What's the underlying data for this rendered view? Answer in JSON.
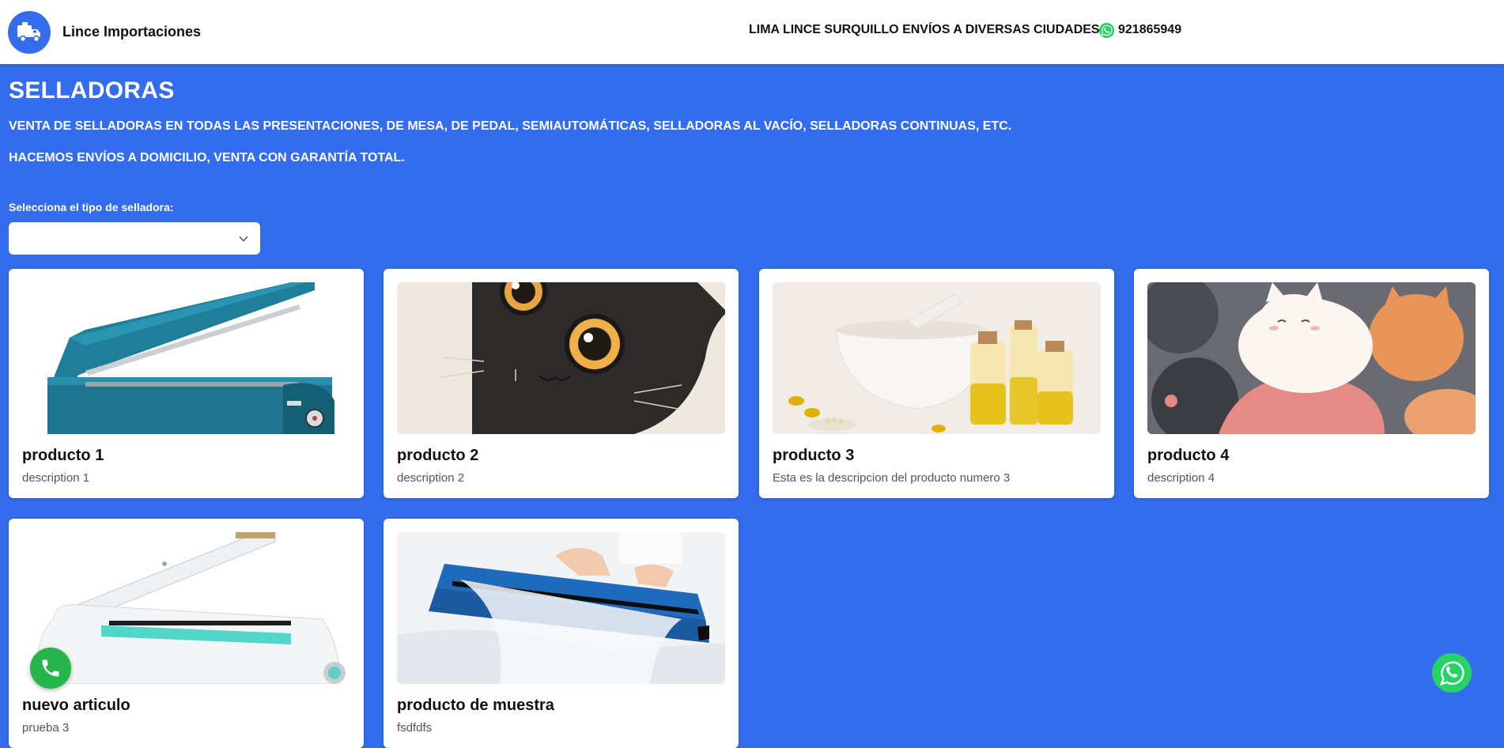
{
  "header": {
    "brand": "Lince Importaciones",
    "info": "LIMA LINCE SURQUILLO ENVÍOS A DIVERSAS CIUDADES",
    "phone": "921865949",
    "logo_icon": "delivery-truck-icon"
  },
  "hero": {
    "title": "SELLADORAS",
    "subtitle_1": "VENTA DE SELLADORAS EN TODAS LAS PRESENTACIONES, DE MESA, DE PEDAL, SEMIAUTOMÁTICAS, SELLADORAS AL VACÍO, SELLADORAS CONTINUAS, ETC.",
    "subtitle_2": "HACEMOS ENVÍOS A DOMICILIO, VENTA CON GARANTÍA TOTAL."
  },
  "filter": {
    "label": "Selecciona el tipo de selladora:",
    "selected": ""
  },
  "products": [
    {
      "title": "producto 1",
      "description": "description 1",
      "image": "teal-impulse-sealer"
    },
    {
      "title": "producto 2",
      "description": "description 2",
      "image": "black-cat-illustration"
    },
    {
      "title": "producto 3",
      "description": "Esta es la descripcion del producto numero 3",
      "image": "mortar-and-oil-bottles"
    },
    {
      "title": "producto 4",
      "description": "description 4",
      "image": "cats-illustration"
    },
    {
      "title": "nuevo articulo",
      "description": "prueba 3",
      "image": "white-impulse-sealer"
    },
    {
      "title": "producto de muestra",
      "description": "fsdfdfs",
      "image": "blue-sealer-with-hands"
    }
  ],
  "colors": {
    "background": "#336ded",
    "whatsapp": "#25d366",
    "phone_button": "#26b54a"
  },
  "floating": {
    "phone_icon": "phone-icon",
    "whatsapp_icon": "whatsapp-icon"
  }
}
